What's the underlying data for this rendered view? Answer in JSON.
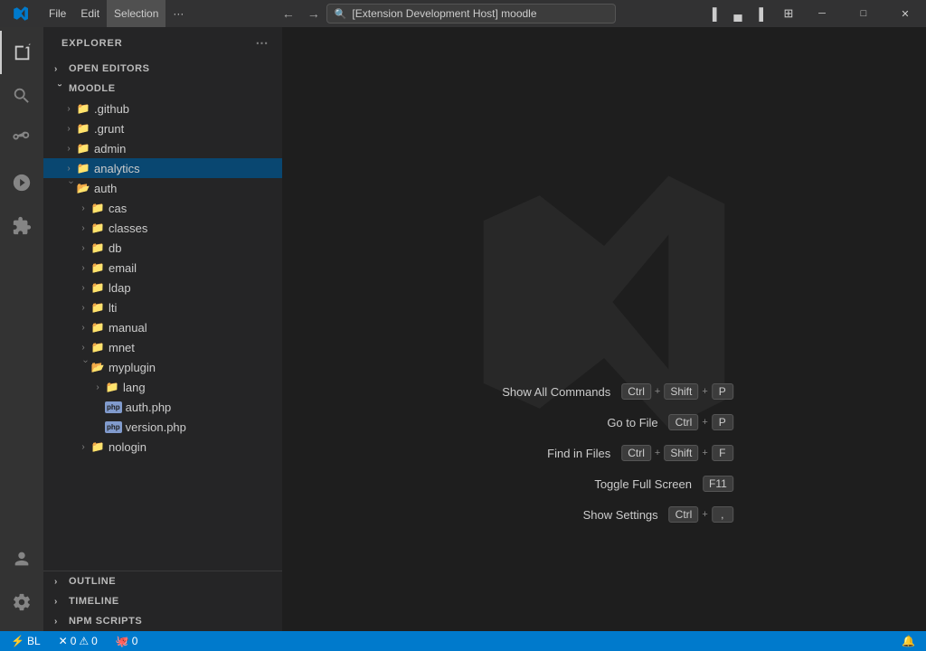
{
  "titlebar": {
    "menus": [
      "File",
      "Edit",
      "Selection",
      "···"
    ],
    "search_placeholder": "[Extension Development Host] moodle",
    "nav_back": "←",
    "nav_forward": "→"
  },
  "activity_bar": {
    "icons": [
      "explorer",
      "search",
      "source-control",
      "run-debug",
      "extensions"
    ]
  },
  "sidebar": {
    "title": "EXPLORER",
    "sections": {
      "open_editors": "OPEN EDITORS",
      "moodle": "MOODLE"
    },
    "tree": [
      {
        "id": "github",
        "label": ".github",
        "level": 1,
        "type": "folder",
        "color": "blue",
        "expanded": false
      },
      {
        "id": "grunt",
        "label": ".grunt",
        "level": 1,
        "type": "folder",
        "color": "blue",
        "expanded": false
      },
      {
        "id": "admin",
        "label": "admin",
        "level": 1,
        "type": "folder",
        "color": "yellow",
        "expanded": false
      },
      {
        "id": "analytics",
        "label": "analytics",
        "level": 1,
        "type": "folder",
        "color": "yellow",
        "expanded": false,
        "selected": true
      },
      {
        "id": "auth",
        "label": "auth",
        "level": 1,
        "type": "folder",
        "color": "yellow",
        "expanded": true
      },
      {
        "id": "cas",
        "label": "cas",
        "level": 2,
        "type": "folder",
        "color": "yellow",
        "expanded": false
      },
      {
        "id": "classes",
        "label": "classes",
        "level": 2,
        "type": "folder",
        "color": "yellow",
        "expanded": false
      },
      {
        "id": "db",
        "label": "db",
        "level": 2,
        "type": "folder",
        "color": "yellow",
        "expanded": false
      },
      {
        "id": "email",
        "label": "email",
        "level": 2,
        "type": "folder",
        "color": "red",
        "expanded": false
      },
      {
        "id": "ldap",
        "label": "ldap",
        "level": 2,
        "type": "folder",
        "color": "yellow",
        "expanded": false
      },
      {
        "id": "lti",
        "label": "lti",
        "level": 2,
        "type": "folder",
        "color": "yellow",
        "expanded": false
      },
      {
        "id": "manual",
        "label": "manual",
        "level": 2,
        "type": "folder",
        "color": "yellow",
        "expanded": false
      },
      {
        "id": "mnet",
        "label": "mnet",
        "level": 2,
        "type": "folder",
        "color": "yellow",
        "expanded": false
      },
      {
        "id": "myplugin",
        "label": "myplugin",
        "level": 2,
        "type": "folder",
        "color": "yellow",
        "expanded": true
      },
      {
        "id": "lang",
        "label": "lang",
        "level": 3,
        "type": "folder",
        "color": "purple",
        "expanded": false
      },
      {
        "id": "auth_php",
        "label": "auth.php",
        "level": 3,
        "type": "file-php"
      },
      {
        "id": "version_php",
        "label": "version.php",
        "level": 3,
        "type": "file-php"
      },
      {
        "id": "nologin",
        "label": "nologin",
        "level": 2,
        "type": "folder",
        "color": "yellow",
        "expanded": false
      }
    ],
    "bottom": {
      "outline": "OUTLINE",
      "timeline": "TIMELINE",
      "npm_scripts": "NPM SCRIPTS"
    }
  },
  "editor": {
    "shortcuts": [
      {
        "label": "Show All Commands",
        "keys": [
          "Ctrl",
          "+",
          "Shift",
          "+",
          "P"
        ]
      },
      {
        "label": "Go to File",
        "keys": [
          "Ctrl",
          "+",
          "P"
        ]
      },
      {
        "label": "Find in Files",
        "keys": [
          "Ctrl",
          "+",
          "Shift",
          "+",
          "F"
        ]
      },
      {
        "label": "Toggle Full Screen",
        "keys": [
          "F11"
        ]
      },
      {
        "label": "Show Settings",
        "keys": [
          "Ctrl",
          "+",
          ","
        ]
      }
    ]
  },
  "statusbar": {
    "errors": "0",
    "warnings": "0",
    "remote": "BL",
    "bell_icon": "🔔"
  }
}
